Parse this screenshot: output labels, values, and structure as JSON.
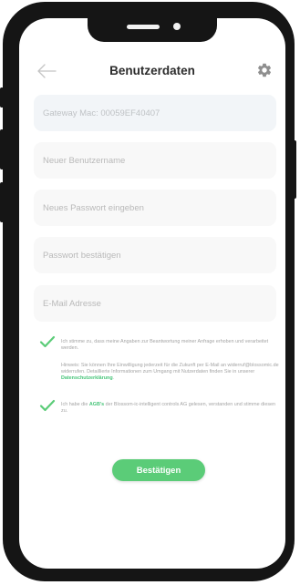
{
  "header": {
    "title": "Benutzerdaten"
  },
  "fields": {
    "gateway_mac": "Gateway Mac: 00059EF40407",
    "username_placeholder": "Neuer Benutzername",
    "password_placeholder": "Neues Passwort eingeben",
    "password_confirm_placeholder": "Passwort bestätigen",
    "email_placeholder": "E-Mail Adresse"
  },
  "consent": {
    "text": "Ich stimme zu, dass meine Angaben zur Beantwortung meiner Anfrage erhoben und verarbeitet werden.",
    "hint_prefix": "Hinweis: Sie können Ihre Einwilligung jederzeit für die Zukunft per E-Mail an widerruf@blossomic.de widerrufen. Detaillierte Informationen zum Umgang mit Nutzerdaten finden Sie in unserer",
    "privacy_link": "Datenschutzerklärung",
    "hint_suffix": "."
  },
  "terms": {
    "prefix": "Ich habe die",
    "agb_link": "AGB's",
    "suffix": "der Blossom-ic-intelligent controls AG gelesen, verstanden und stimme diesen zu."
  },
  "actions": {
    "confirm_label": "Bestätigen"
  },
  "colors": {
    "accent": "#5bcc78",
    "frame": "#151515",
    "field_bg": "#f8f8f8"
  },
  "icons": {
    "back": "arrow-left-icon",
    "settings": "gear-icon",
    "check": "checkmark-icon"
  }
}
